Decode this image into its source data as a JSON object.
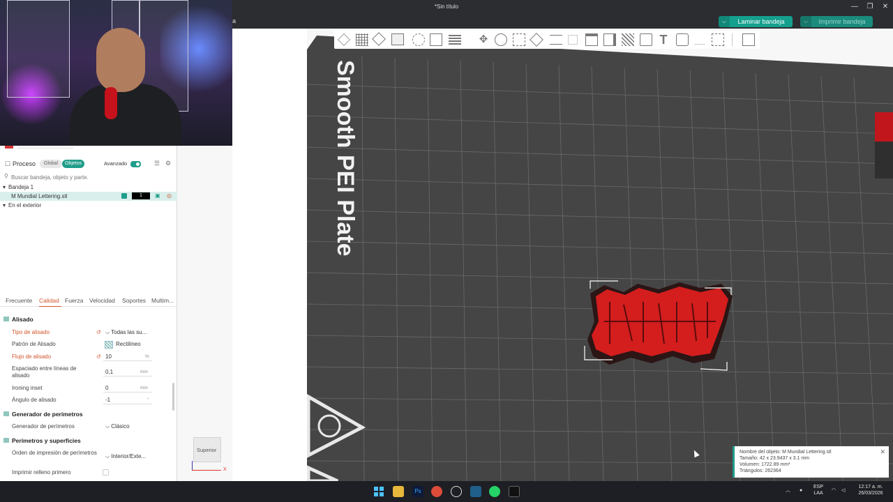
{
  "window": {
    "title": "*Sin título",
    "minimize": "—",
    "maximize": "❐",
    "close": "✕"
  },
  "topbar": {
    "partial_text": "a",
    "slice_button": "Laminar bandeja",
    "print_button": "Imprimir bandeja"
  },
  "plate": {
    "label": "Smooth PEI Plate"
  },
  "view_cube": {
    "label": "Superior",
    "axis_x": "X"
  },
  "panel": {
    "process_label": "Proceso",
    "global_pill": "Global",
    "objects_pill": "Objetos",
    "advanced_label": "Avanzado",
    "search_placeholder": "Buscar bandeja, objeto y parte.",
    "tree": {
      "plate": "Bandeja 1",
      "object": "M Mundial Lettering.stl",
      "object_count": "1",
      "outside": "En el exterior"
    },
    "tabs": [
      "Frecuente",
      "Calidad",
      "Fuerza",
      "Velocidad",
      "Soportes",
      "Multim..."
    ],
    "sections": {
      "ironing": "Alisado",
      "wall_generator": "Generador de perímetros",
      "walls_surfaces": "Perímetros y superficies"
    },
    "params": {
      "ironing_type": {
        "label": "Tipo de alisado",
        "value": "Todas las su..."
      },
      "ironing_pattern": {
        "label": "Patrón de Alisado",
        "value": "Rectilíneo"
      },
      "ironing_flow": {
        "label": "Flujo de alisado",
        "value": "10",
        "unit": "%"
      },
      "ironing_spacing": {
        "label": "Espaciado entre líneas de alisado",
        "value": "0,1",
        "unit": "mm"
      },
      "ironing_inset": {
        "label": "Ironing inset",
        "value": "0",
        "unit": "mm"
      },
      "ironing_angle": {
        "label": "Ángulo de alisado",
        "value": "-1",
        "unit": "°"
      },
      "wall_gen": {
        "label": "Generador de perímetros",
        "value": "Clásico"
      },
      "wall_order": {
        "label": "Orden de impresión de perímetros",
        "value": "Interior/Exte..."
      },
      "infill_first": {
        "label": "Imprimir relleno primero"
      }
    }
  },
  "object_info": {
    "name": "Nombre del objeto: M Mundial Lettering.stl",
    "size": "Tamaño: 42 x 23.9437 x 3.1 mm",
    "volume": "Volumen: 1722.89 mm³",
    "triangles": "Triángulos: 262364"
  },
  "taskbar": {
    "lang_top": "ESP",
    "lang_bottom": "LAA",
    "time": "12:17 a. m.",
    "date": "26/03/2026",
    "ps_label": "Ps"
  },
  "colors": {
    "accent": "#1f9d8a",
    "modified": "#d0542a",
    "bed": "#454545",
    "model": "#d41d1d"
  }
}
